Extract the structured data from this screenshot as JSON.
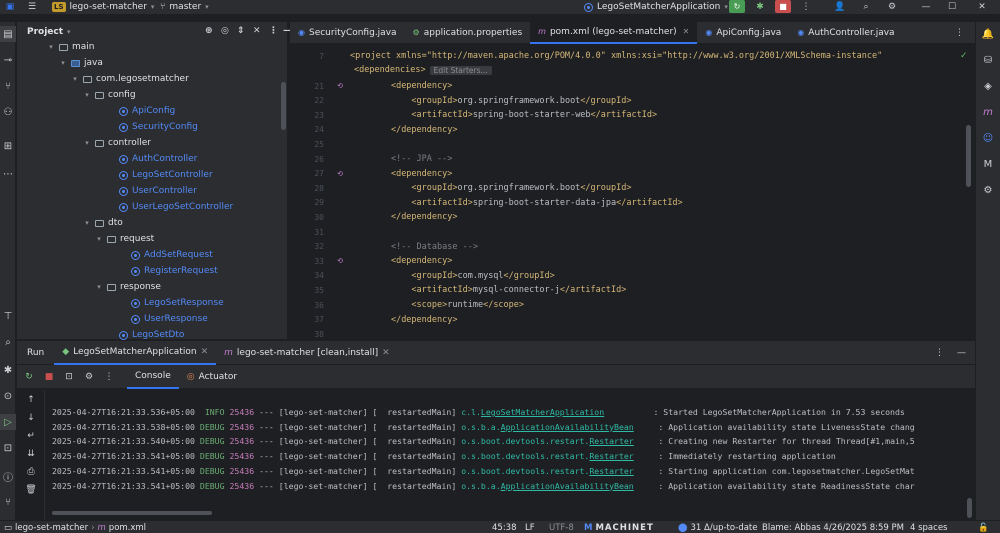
{
  "titlebar": {
    "project_badge": "LS",
    "project_name": "lego-set-matcher",
    "branch": "master",
    "run_config": "LegoSetMatcherApplication"
  },
  "project_panel": {
    "title": "Project",
    "tree": [
      {
        "label": "main",
        "kind": "folder"
      },
      {
        "label": "java",
        "kind": "folder-blue"
      },
      {
        "label": "com.legosetmatcher",
        "kind": "package"
      },
      {
        "label": "config",
        "kind": "package"
      },
      {
        "label": "ApiConfig",
        "kind": "class"
      },
      {
        "label": "SecurityConfig",
        "kind": "class"
      },
      {
        "label": "controller",
        "kind": "package"
      },
      {
        "label": "AuthController",
        "kind": "class"
      },
      {
        "label": "LegoSetController",
        "kind": "class"
      },
      {
        "label": "UserController",
        "kind": "class"
      },
      {
        "label": "UserLegoSetController",
        "kind": "class"
      },
      {
        "label": "dto",
        "kind": "package"
      },
      {
        "label": "request",
        "kind": "package"
      },
      {
        "label": "AddSetRequest",
        "kind": "class"
      },
      {
        "label": "RegisterRequest",
        "kind": "class"
      },
      {
        "label": "response",
        "kind": "package"
      },
      {
        "label": "LegoSetResponse",
        "kind": "class"
      },
      {
        "label": "UserResponse",
        "kind": "class"
      },
      {
        "label": "LegoSetDto",
        "kind": "class"
      }
    ]
  },
  "editor_tabs": [
    {
      "label": "SecurityConfig.java",
      "icon": "class-icon"
    },
    {
      "label": "application.properties",
      "icon": "properties-icon"
    },
    {
      "label": "pom.xml (lego-set-matcher)",
      "icon": "maven-icon",
      "active": true
    },
    {
      "label": "ApiConfig.java",
      "icon": "class-icon"
    },
    {
      "label": "AuthController.java",
      "icon": "class-icon"
    }
  ],
  "editor": {
    "header_line_number": "7",
    "project_tag_line": "<project xmlns=\"http://maven.apache.org/POM/4.0.0\" xmlns:xsi=\"http://www.w3.org/2001/XMLSchema-instance\"",
    "deps_crumb": "<dependencies>",
    "edit_starters": "Edit Starters...",
    "lines": [
      {
        "n": "21",
        "gutter": true,
        "indent": "        ",
        "parts": [
          [
            "tagc",
            "<dependency>"
          ]
        ]
      },
      {
        "n": "22",
        "indent": "            ",
        "parts": [
          [
            "tagc",
            "<groupId>"
          ],
          [
            "txt",
            "org.springframework.boot"
          ],
          [
            "tagc",
            "</groupId>"
          ]
        ]
      },
      {
        "n": "23",
        "indent": "            ",
        "parts": [
          [
            "tagc",
            "<artifactId>"
          ],
          [
            "txt",
            "spring-boot-starter-web"
          ],
          [
            "tagc",
            "</artifactId>"
          ]
        ]
      },
      {
        "n": "24",
        "indent": "        ",
        "parts": [
          [
            "tagc",
            "</dependency>"
          ]
        ]
      },
      {
        "n": "25",
        "indent": "",
        "parts": []
      },
      {
        "n": "26",
        "indent": "        ",
        "parts": [
          [
            "cmt",
            "<!-- JPA -->"
          ]
        ]
      },
      {
        "n": "27",
        "gutter": true,
        "indent": "        ",
        "parts": [
          [
            "tagc",
            "<dependency>"
          ]
        ]
      },
      {
        "n": "28",
        "indent": "            ",
        "parts": [
          [
            "tagc",
            "<groupId>"
          ],
          [
            "txt",
            "org.springframework.boot"
          ],
          [
            "tagc",
            "</groupId>"
          ]
        ]
      },
      {
        "n": "29",
        "indent": "            ",
        "parts": [
          [
            "tagc",
            "<artifactId>"
          ],
          [
            "txt",
            "spring-boot-starter-data-jpa"
          ],
          [
            "tagc",
            "</artifactId>"
          ]
        ]
      },
      {
        "n": "30",
        "indent": "        ",
        "parts": [
          [
            "tagc",
            "</dependency>"
          ]
        ]
      },
      {
        "n": "31",
        "indent": "",
        "parts": []
      },
      {
        "n": "32",
        "indent": "        ",
        "parts": [
          [
            "cmt",
            "<!-- Database -->"
          ]
        ]
      },
      {
        "n": "33",
        "gutter": true,
        "indent": "        ",
        "parts": [
          [
            "tagc",
            "<dependency>"
          ]
        ]
      },
      {
        "n": "34",
        "indent": "            ",
        "parts": [
          [
            "tagc",
            "<groupId>"
          ],
          [
            "txt",
            "com.mysql"
          ],
          [
            "tagc",
            "</groupId>"
          ]
        ]
      },
      {
        "n": "35",
        "indent": "            ",
        "parts": [
          [
            "tagc",
            "<artifactId>"
          ],
          [
            "txt",
            "mysql-connector-j"
          ],
          [
            "tagc",
            "</artifactId>"
          ]
        ]
      },
      {
        "n": "36",
        "indent": "            ",
        "parts": [
          [
            "tagc",
            "<scope>"
          ],
          [
            "txt",
            "runtime"
          ],
          [
            "tagc",
            "</scope>"
          ]
        ]
      },
      {
        "n": "37",
        "indent": "        ",
        "parts": [
          [
            "tagc",
            "</dependency>"
          ]
        ]
      },
      {
        "n": "38",
        "indent": "",
        "parts": []
      }
    ]
  },
  "run_panel": {
    "title": "Run",
    "tabs": [
      {
        "label": "LegoSetMatcherApplication",
        "active": true
      },
      {
        "label": "lego-set-matcher [clean,install]"
      }
    ],
    "subtabs": [
      {
        "label": "Console",
        "active": true
      },
      {
        "label": "Actuator"
      }
    ],
    "logs": [
      {
        "ts": "2025-04-27T16:21:33.536+05:00",
        "level": " INFO",
        "pid": "25436",
        "sep": " --- ",
        "app": "[lego-set-matcher] [",
        "thread": "  restartedMain] ",
        "logger": "c.l.",
        "logger_link": "LegoSetMatcherApplication",
        "pad": "          ",
        "msg": ": Started LegoSetMatcherApplication in 7.53 seconds"
      },
      {
        "ts": "2025-04-27T16:21:33.538+05:00",
        "level": "DEBUG",
        "pid": "25436",
        "sep": " --- ",
        "app": "[lego-set-matcher] [",
        "thread": "  restartedMain] ",
        "logger": "o.s.b.a.",
        "logger_link": "ApplicationAvailabilityBean",
        "pad": "     ",
        "msg": ": Application availability state LivenessState chang"
      },
      {
        "ts": "2025-04-27T16:21:33.540+05:00",
        "level": "DEBUG",
        "pid": "25436",
        "sep": " --- ",
        "app": "[lego-set-matcher] [",
        "thread": "  restartedMain] ",
        "logger": "o.s.boot.devtools.restart.",
        "logger_link": "Restarter",
        "pad": "     ",
        "msg": ": Creating new Restarter for thread Thread[#1,main,5"
      },
      {
        "ts": "2025-04-27T16:21:33.541+05:00",
        "level": "DEBUG",
        "pid": "25436",
        "sep": " --- ",
        "app": "[lego-set-matcher] [",
        "thread": "  restartedMain] ",
        "logger": "o.s.boot.devtools.restart.",
        "logger_link": "Restarter",
        "pad": "     ",
        "msg": ": Immediately restarting application"
      },
      {
        "ts": "2025-04-27T16:21:33.541+05:00",
        "level": "DEBUG",
        "pid": "25436",
        "sep": " --- ",
        "app": "[lego-set-matcher] [",
        "thread": "  restartedMain] ",
        "logger": "o.s.boot.devtools.restart.",
        "logger_link": "Restarter",
        "pad": "     ",
        "msg": ": Starting application com.legosetmatcher.LegoSetMat"
      },
      {
        "ts": "2025-04-27T16:21:33.541+05:00",
        "level": "DEBUG",
        "pid": "25436",
        "sep": " --- ",
        "app": "[lego-set-matcher] [",
        "thread": "  restartedMain] ",
        "logger": "o.s.b.a.",
        "logger_link": "ApplicationAvailabilityBean",
        "pad": "     ",
        "msg": ": Application availability state ReadinessState char"
      }
    ]
  },
  "statusbar": {
    "crumb_project": "lego-set-matcher",
    "crumb_file": "pom.xml",
    "position": "45:38",
    "line_sep": "LF",
    "encoding": "UTF-8",
    "plugin": "MACHINET",
    "vcs": "31 Δ/up-to-date",
    "blame": "Blame: Abbas 4/26/2025 8:59 PM",
    "indent": "4 spaces"
  }
}
